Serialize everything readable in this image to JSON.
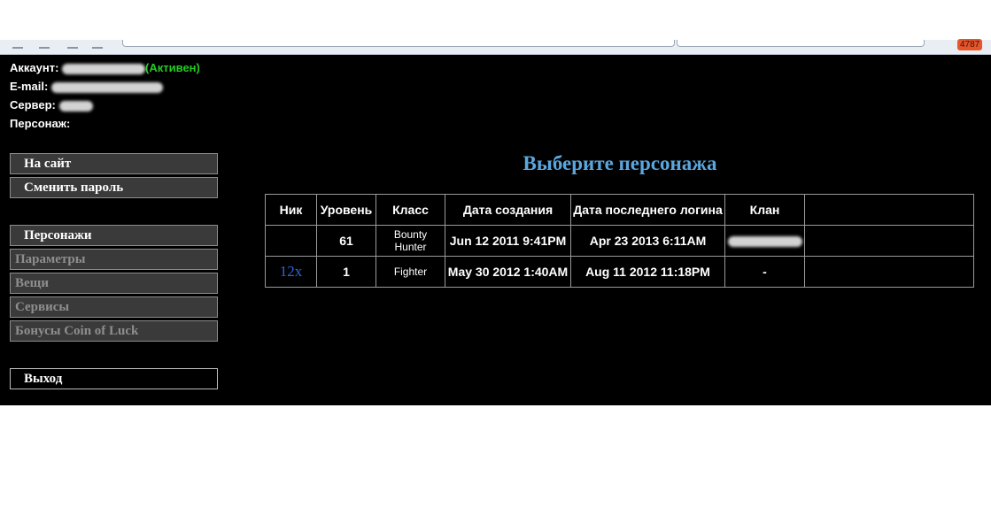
{
  "browser": {
    "notification_count": "4787"
  },
  "account": {
    "account_label": "Аккаунт:",
    "status": "(Активен)",
    "email_label": "E-mail:",
    "server_label": "Сервер:",
    "character_label": "Персонаж:"
  },
  "menu": {
    "to_site": "На сайт",
    "change_password": "Сменить пароль",
    "characters": "Персонажи",
    "parameters": "Параметры",
    "items": "Вещи",
    "services": "Сервисы",
    "bonuses": "Бонусы Coin of Luck",
    "logout": "Выход"
  },
  "main": {
    "heading": "Выберите персонажа",
    "table": {
      "headers": [
        "Ник",
        "Уровень",
        "Класс",
        "Дата создания",
        "Дата последнего логина",
        "Клан",
        ""
      ],
      "rows": [
        {
          "nick": "",
          "level": "61",
          "class": "Bounty Hunter",
          "created": "Jun 12 2011 9:41PM",
          "last_login": "Apr 23 2013 6:11AM",
          "clan": ""
        },
        {
          "nick": "12x",
          "level": "1",
          "class": "Fighter",
          "created": "May 30 2012 1:40AM",
          "last_login": "Aug 11 2012 11:18PM",
          "clan": "-"
        }
      ]
    }
  }
}
